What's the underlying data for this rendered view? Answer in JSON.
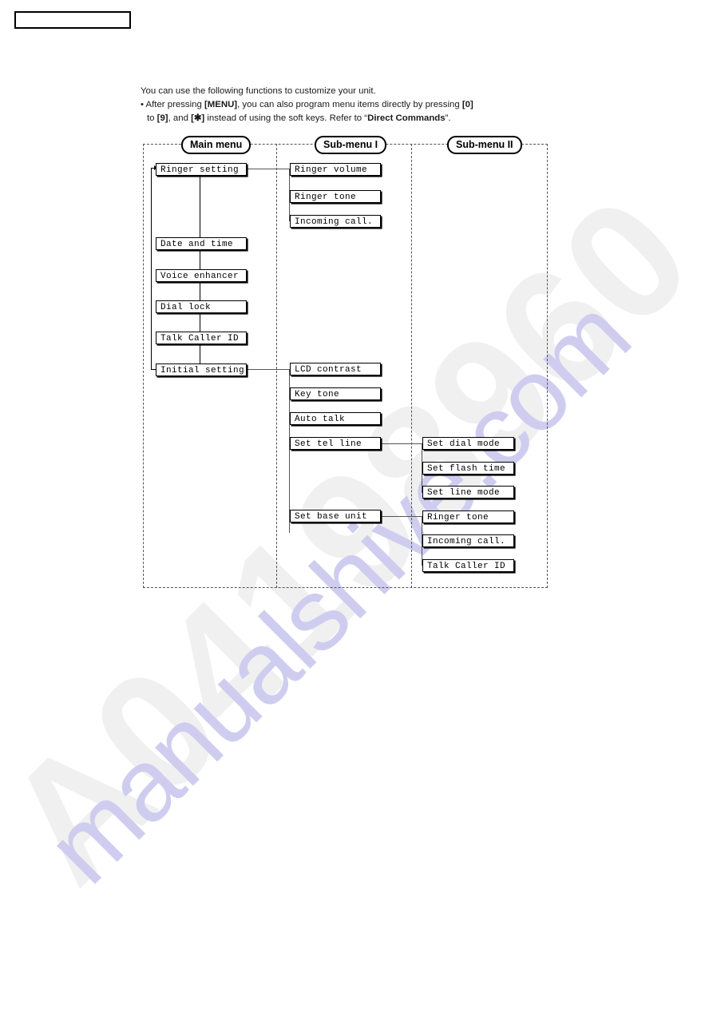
{
  "page": {
    "header_box_label": ""
  },
  "intro": {
    "line1": "You can use the following functions to customize your unit.",
    "line2_a": "• After pressing ",
    "line2_menu": "[MENU]",
    "line2_b": ", you can also program menu items directly by pressing ",
    "line2_zero": "[0]",
    "line3_a": "to ",
    "line3_nine": "[9]",
    "line3_b": ", and ",
    "line3_star": "[✱]",
    "line3_c": " instead of using the soft keys. Refer to “",
    "line3_cmd": "Direct Commands",
    "line3_d": "”."
  },
  "diagram": {
    "columns": [
      {
        "id": "main",
        "label": "Main menu"
      },
      {
        "id": "sub1",
        "label": "Sub-menu I"
      },
      {
        "id": "sub2",
        "label": "Sub-menu II"
      }
    ],
    "main_menu": [
      {
        "label": "Ringer setting"
      },
      {
        "label": "Date and time"
      },
      {
        "label": "Voice enhancer"
      },
      {
        "label": "Dial lock"
      },
      {
        "label": "Talk Caller ID"
      },
      {
        "label": "Initial setting"
      }
    ],
    "sub_menu_1_ringer": [
      {
        "label": "Ringer volume"
      },
      {
        "label": "Ringer tone"
      },
      {
        "label": "Incoming call."
      }
    ],
    "sub_menu_1_initial": [
      {
        "label": "LCD contrast"
      },
      {
        "label": "Key tone"
      },
      {
        "label": "Auto talk"
      },
      {
        "label": "Set tel line"
      },
      {
        "label": "Set base unit"
      }
    ],
    "sub_menu_2_tel_line": [
      {
        "label": "Set dial mode"
      },
      {
        "label": "Set flash time"
      },
      {
        "label": "Set line mode"
      }
    ],
    "sub_menu_2_base_unit": [
      {
        "label": "Ringer tone"
      },
      {
        "label": "Incoming call."
      },
      {
        "label": "Talk Caller ID"
      }
    ]
  },
  "watermarks": {
    "serial": "A04198960",
    "site": "manualshive.com"
  },
  "colors": {
    "ink": "#000000",
    "dashed_rule": "#555555",
    "watermark_serial": "#f0f0f0",
    "watermark_site": "#cfcdef"
  }
}
